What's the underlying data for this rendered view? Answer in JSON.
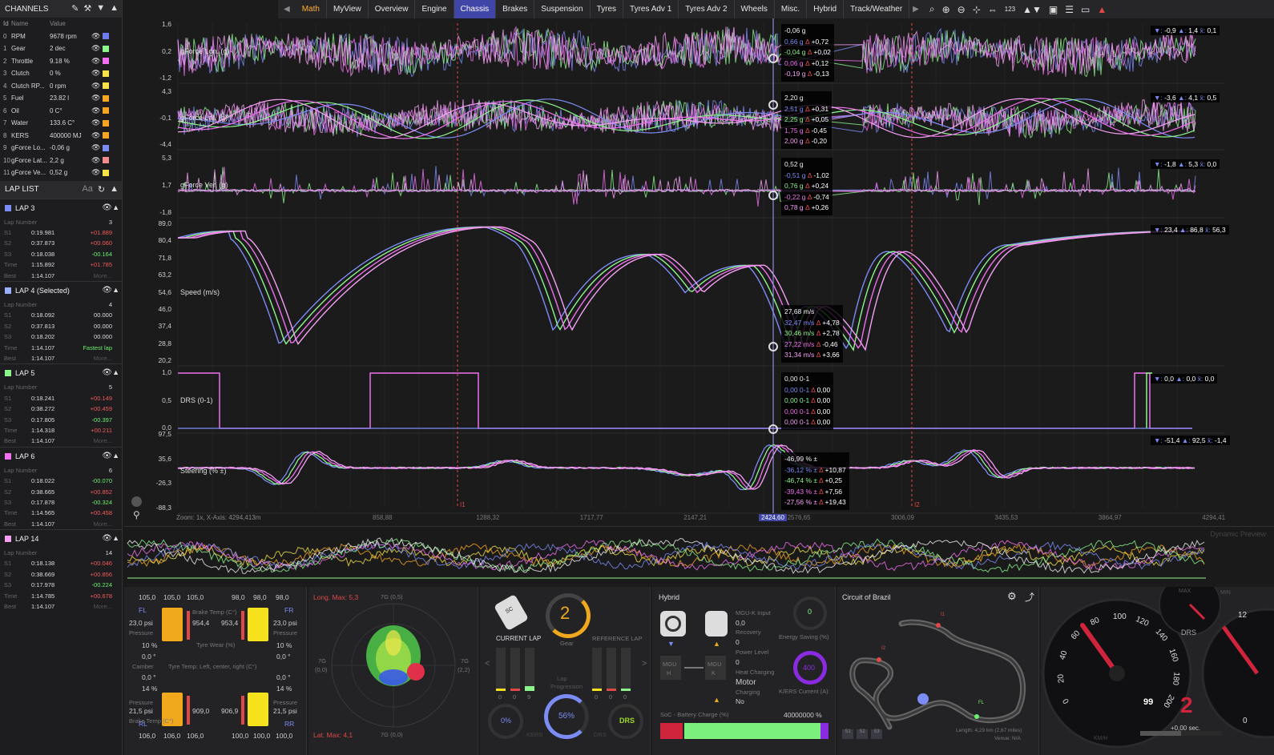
{
  "channels_panel": {
    "title": "CHANNELS",
    "col_id": "Id",
    "col_name": "Name",
    "col_value": "Value",
    "rows": [
      {
        "id": "0",
        "name": "RPM",
        "value": "9678 rpm",
        "color": "#6f7cf0"
      },
      {
        "id": "1",
        "name": "Gear",
        "value": "2 dec",
        "color": "#8cf58c"
      },
      {
        "id": "2",
        "name": "Throttle",
        "value": "9.18 %",
        "color": "#f070f0"
      },
      {
        "id": "3",
        "name": "Clutch",
        "value": "0 %",
        "color": "#f5e24a"
      },
      {
        "id": "4",
        "name": "Clutch RP...",
        "value": "0 rpm",
        "color": "#f5e24a"
      },
      {
        "id": "5",
        "name": "Fuel",
        "value": "23.82 l",
        "color": "#f5a623"
      },
      {
        "id": "6",
        "name": "Oil",
        "value": "0 C°",
        "color": "#f5a623"
      },
      {
        "id": "7",
        "name": "Water",
        "value": "133.6 C°",
        "color": "#f5a623"
      },
      {
        "id": "8",
        "name": "KERS",
        "value": "400000 MJ",
        "color": "#f5a623"
      },
      {
        "id": "9",
        "name": "gForce Lo...",
        "value": "-0,06 g",
        "color": "#7c8cf5"
      },
      {
        "id": "10",
        "name": "gForce Lat...",
        "value": "2,2 g",
        "color": "#f58c8c"
      },
      {
        "id": "11",
        "name": "gForce Ve...",
        "value": "0,52 g",
        "color": "#f5e24a"
      }
    ]
  },
  "lap_list": {
    "title": "LAP LIST",
    "aa": "Aa",
    "laps": [
      {
        "name": "LAP 3",
        "color": "#7c8cf5",
        "number": "3",
        "s1": "0:19.981",
        "d1": "+01.889",
        "s2": "0:37.873",
        "d2": "+00.060",
        "s3": "0:18.038",
        "d3": "-00.164",
        "time": "1:15.892",
        "dt": "+01.785",
        "best": "1:14.107",
        "more": "More...",
        "c1": "#f05a5a",
        "c2": "#f05a5a",
        "c3": "#6cf06c",
        "ct": "#f05a5a"
      },
      {
        "name": "LAP 4 (Selected)",
        "color": "#9ab0ff",
        "number": "4",
        "s1": "0:18.092",
        "d1": "00.000",
        "s2": "0:37.813",
        "d2": "00.000",
        "s3": "0:18.202",
        "d3": "00.000",
        "time": "1:14.107",
        "dt": "Fastest lap",
        "best": "1:14.107",
        "more": "More...",
        "c1": "#ddd",
        "c2": "#ddd",
        "c3": "#ddd",
        "ct": "#6cf06c"
      },
      {
        "name": "LAP 5",
        "color": "#8cf58c",
        "number": "5",
        "s1": "0:18.241",
        "d1": "+00.149",
        "s2": "0:38.272",
        "d2": "+00.459",
        "s3": "0:17.805",
        "d3": "-00.397",
        "time": "1:14.318",
        "dt": "+00.211",
        "best": "1:14.107",
        "more": "More...",
        "c1": "#f05a5a",
        "c2": "#f05a5a",
        "c3": "#6cf06c",
        "ct": "#f05a5a"
      },
      {
        "name": "LAP 6",
        "color": "#f070f0",
        "number": "6",
        "s1": "0:18.022",
        "d1": "-00.070",
        "s2": "0:38.665",
        "d2": "+00.852",
        "s3": "0:17.878",
        "d3": "-00.324",
        "time": "1:14.565",
        "dt": "+00.458",
        "best": "1:14.107",
        "more": "More...",
        "c1": "#6cf06c",
        "c2": "#f05a5a",
        "c3": "#6cf06c",
        "ct": "#f05a5a"
      },
      {
        "name": "LAP 14",
        "color": "#f5a0f5",
        "number": "14",
        "s1": "0:18.138",
        "d1": "+00.046",
        "s2": "0:38.669",
        "d2": "+00.856",
        "s3": "0:17.978",
        "d3": "-00.224",
        "time": "1:14.785",
        "dt": "+00.678",
        "best": "1:14.107",
        "more": "More...",
        "c1": "#f05a5a",
        "c2": "#f05a5a",
        "c3": "#6cf06c",
        "ct": "#f05a5a"
      }
    ],
    "labels": {
      "lapnum": "Lap Number",
      "s1": "S1",
      "s2": "S2",
      "s3": "S3",
      "time": "Time",
      "best": "Best"
    }
  },
  "tabs": [
    "Math",
    "MyView",
    "Overview",
    "Engine",
    "Chassis",
    "Brakes",
    "Suspension",
    "Tyres",
    "Tyres Adv 1",
    "Tyres Adv 2",
    "Wheels",
    "Misc.",
    "Hybrid",
    "Track/Weather"
  ],
  "selected_tab": "Chassis",
  "toolbar_123": "123",
  "chart": {
    "zoom_label": "Zoom: 1x, X-Axis: 4294,413m",
    "x_ticks": [
      "858,88",
      "1288,32",
      "1717,77",
      "2147,21",
      "2576,65",
      "3006,09",
      "3435,53",
      "3864,97",
      "4294,41"
    ],
    "cursor_x": "2424,60",
    "marker_i1": "I1",
    "marker_i2": "I2",
    "channels": [
      {
        "name": "gForce Lon. (g)",
        "yticks": [
          "1,6",
          "0,2",
          "-1,2"
        ],
        "stats": {
          "min": "-0,9",
          "max": "1,4",
          "avg": "0,1"
        },
        "readout": [
          {
            "v": "-0,06 g",
            "d": ""
          },
          {
            "v": "0,66 g",
            "d": "+0,72"
          },
          {
            "v": "-0,04 g",
            "d": "+0,02"
          },
          {
            "v": "0,06 g",
            "d": "+0,12"
          },
          {
            "v": "-0,19 g",
            "d": "-0,13"
          }
        ]
      },
      {
        "name": "gForce Lat. (g)",
        "yticks": [
          "4,3",
          "-0,1",
          "-4,4"
        ],
        "stats": {
          "min": "-3,6",
          "max": "4,1",
          "avg": "0,5"
        },
        "readout": [
          {
            "v": "2,20 g",
            "d": ""
          },
          {
            "v": "2,51 g",
            "d": "+0,31"
          },
          {
            "v": "2,25 g",
            "d": "+0,05"
          },
          {
            "v": "1,75 g",
            "d": "-0,45"
          },
          {
            "v": "2,00 g",
            "d": "-0,20"
          }
        ]
      },
      {
        "name": "gForce Ver. (g)",
        "yticks": [
          "5,3",
          "1,7",
          "-1,8"
        ],
        "stats": {
          "min": "-1,8",
          "max": "5,3",
          "avg": "0,0"
        },
        "readout": [
          {
            "v": "0,52 g",
            "d": ""
          },
          {
            "v": "-0,51 g",
            "d": "-1,02"
          },
          {
            "v": "0,76 g",
            "d": "+0,24"
          },
          {
            "v": "-0,22 g",
            "d": "-0,74"
          },
          {
            "v": "0,78 g",
            "d": "+0,26"
          }
        ]
      },
      {
        "name": "Speed (m/s)",
        "yticks": [
          "89,0",
          "80,4",
          "71,8",
          "63,2",
          "54,6",
          "46,0",
          "37,4",
          "28,8",
          "20,2"
        ],
        "stats": {
          "min": "23,4",
          "max": "86,8",
          "avg": "56,3"
        },
        "readout": [
          {
            "v": "27,68 m/s",
            "d": ""
          },
          {
            "v": "32,47 m/s",
            "d": "+4,78"
          },
          {
            "v": "30,46 m/s",
            "d": "+2,78"
          },
          {
            "v": "27,22 m/s",
            "d": "-0,46"
          },
          {
            "v": "31,34 m/s",
            "d": "+3,66"
          }
        ]
      },
      {
        "name": "DRS (0-1)",
        "yticks": [
          "1,0",
          "0,5",
          "0,0"
        ],
        "stats": {
          "min": "0,0",
          "max": "0,0",
          "avg": "0,0"
        },
        "readout": [
          {
            "v": "0,00 0-1",
            "d": ""
          },
          {
            "v": "0,00 0-1",
            "d": "0,00"
          },
          {
            "v": "0,00 0-1",
            "d": "0,00"
          },
          {
            "v": "0,00 0-1",
            "d": "0,00"
          },
          {
            "v": "0,00 0-1",
            "d": "0,00"
          }
        ]
      },
      {
        "name": "Steering (% ±)",
        "yticks": [
          "97,5",
          "35,6",
          "-26,3",
          "-88,3"
        ],
        "stats": {
          "min": "-51,4",
          "max": "92,5",
          "avg": "-1,4"
        },
        "readout": [
          {
            "v": "-46,99 % ±",
            "d": ""
          },
          {
            "v": "-36,12 % ±",
            "d": "+10,87"
          },
          {
            "v": "-46,74 % ±",
            "d": "+0,25"
          },
          {
            "v": "-39,43 % ±",
            "d": "+7,56"
          },
          {
            "v": "-27,56 % ±",
            "d": "+19,43"
          }
        ]
      }
    ],
    "series_colors": [
      "#f0f0f0",
      "#7c8cf5",
      "#8cf58c",
      "#f070f0",
      "#f5a0f5"
    ]
  },
  "preview_label": "Dynamic Preview",
  "tyres": {
    "fl_label": "FL",
    "fr_label": "FR",
    "rl_label": "RL",
    "rr_label": "RR",
    "fl_temps": [
      "105,0",
      "105,0",
      "105,0"
    ],
    "fr_temps": [
      "98,0",
      "98,0",
      "98,0"
    ],
    "rl_temps": [
      "106,0",
      "106,0",
      "106,0"
    ],
    "rr_temps": [
      "100,0",
      "100,0",
      "100,0"
    ],
    "fl_press": "23,0 psi",
    "fr_press": "23,0 psi",
    "rl_press": "21,5 psi",
    "rr_press": "21,5 psi",
    "f_brake_l": "954,4",
    "f_brake_r": "953,4",
    "r_brake_l": "909,0",
    "r_brake_r": "906,9",
    "f_wear_l": "10 %",
    "f_wear_r": "10 %",
    "r_wear_l": "14 %",
    "r_wear_r": "14 %",
    "f_cam_l": "0,0 °",
    "f_cam_r": "0,0 °",
    "r_cam_l": "0,0 °",
    "r_cam_r": "0,0 °",
    "lbl_pressure": "Pressure",
    "lbl_brake": "Brake Temp (C°)",
    "lbl_wear": "Tyre Wear (%)",
    "lbl_camber": "Camber",
    "lbl_temp": "Tyre Temp: Left, center, right (C°)"
  },
  "gg": {
    "long_max": "Long. Max: 5,3",
    "lat_max": "Lat. Max: 4,1",
    "top": "7G (0,5)",
    "bottom": "7G (0,0)",
    "left": "7G\n(0,0)",
    "right": "7G\n(2,2)",
    "left1": "7G",
    "left2": "(0,0)",
    "right1": "7G",
    "right2": "(2,2)"
  },
  "current_lap": {
    "title": "CURRENT LAP",
    "gear": "2",
    "gear_lbl": "Gear",
    "ref": "REFERENCE LAP",
    "progress": "Lap\nProgression",
    "prog_lbl1": "Lap",
    "prog_lbl2": "Progression",
    "kers": "0%",
    "kers_lbl": "KERS",
    "prog": "56%",
    "drs": "DRS",
    "drs_lbl": "DRS",
    "b1": "0",
    "b2": "0",
    "b3": "9",
    "r1": "0",
    "r2": "0",
    "r3": "0",
    "badge": "SC"
  },
  "hybrid": {
    "title": "Hybrid",
    "mguk_input": "MGU-K Input",
    "recovery": "Recovery",
    "v00": "0,0",
    "v0a": "0",
    "power_level": "Power Level",
    "v0b": "0",
    "heat": "Heat Charging",
    "motor": "Motor",
    "charging": "Charging",
    "no": "No",
    "energy": "Energy Saving (%)",
    "e0": "0",
    "ers": "K/ERS Current (A)",
    "ers_v": "400",
    "soc": "SoC - Battery Charge (%)",
    "soc_v": "40000000 %",
    "mguh": "MGU\nH",
    "mguh1": "MGU",
    "mguh2": "H",
    "mguk1": "MGU",
    "mguk2": "K"
  },
  "track": {
    "title": "Circuit of Brazil",
    "length": "Length: 4,29 km (2,67 miles)",
    "venue": "Venue: N/A",
    "fl": "FL",
    "i1": "I1",
    "i2": "I2",
    "s1": "S1",
    "s2": "S2",
    "s3": "S3"
  },
  "dash": {
    "speed": "99",
    "gear": "2",
    "delta": "+0,00 sec.",
    "drs": "DRS",
    "max": "MAX",
    "min": "MIN",
    "kmh": "KM/H",
    "ticks": [
      "0",
      "20",
      "40",
      "60",
      "80",
      "100",
      "120",
      "140",
      "160",
      "180",
      "200"
    ],
    "rticks": [
      "12",
      "0"
    ]
  }
}
